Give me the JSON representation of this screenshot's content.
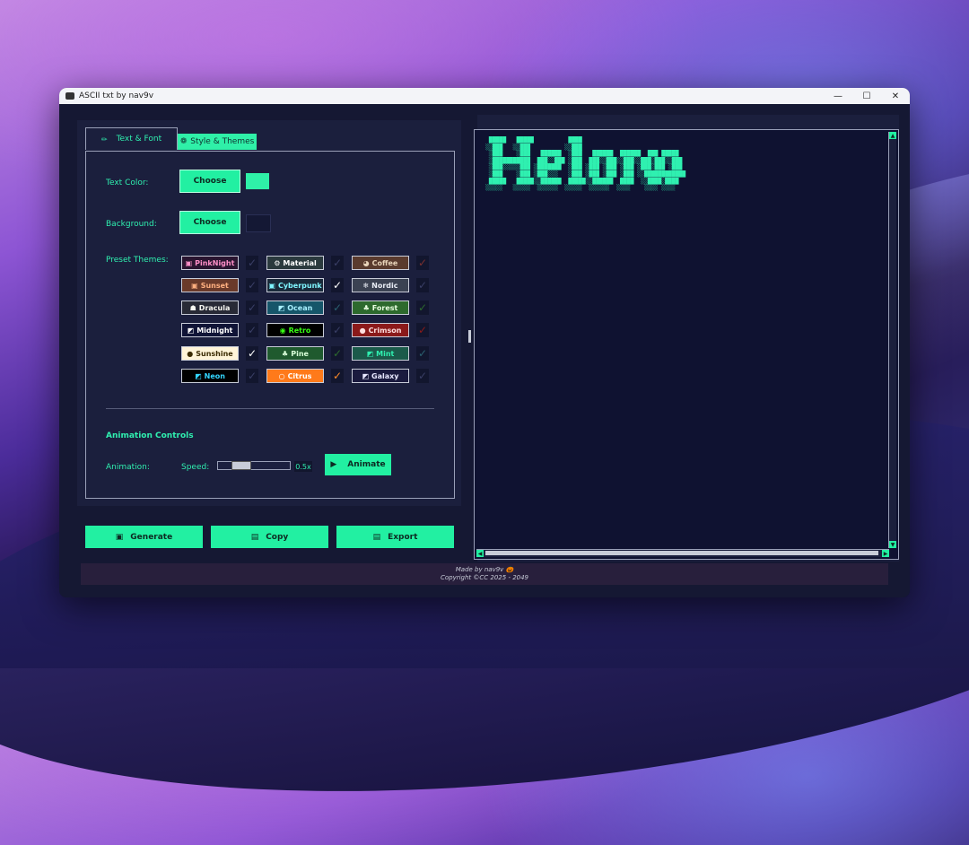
{
  "window": {
    "title": "ASCII txt by nav9v",
    "controls": [
      "—",
      "☐",
      "✕"
    ]
  },
  "tabs": [
    {
      "label": "Text & Font",
      "icon": "✏"
    },
    {
      "label": "Style & Themes",
      "icon": "❁"
    }
  ],
  "style": {
    "text_color_label": "Text Color:",
    "background_label": "Background:",
    "choose_label": "Choose",
    "text_color_value": "#2ff0a8",
    "background_value": "#141834",
    "preset_label": "Preset Themes:"
  },
  "themes": [
    {
      "name": "PinkNight",
      "icon": "▣",
      "fg": "#ff8fc8",
      "bg": "#2a1530",
      "checked": false,
      "check_color": "#3a3f66"
    },
    {
      "name": "Material",
      "icon": "⚙",
      "fg": "#ffffff",
      "bg": "#2b3a3e",
      "checked": false,
      "check_color": "#3a3f66"
    },
    {
      "name": "Coffee",
      "icon": "◕",
      "fg": "#e8d3b9",
      "bg": "#5a3b2e",
      "checked": false,
      "check_color": "#7a3030"
    },
    {
      "name": "Sunset",
      "icon": "▣",
      "fg": "#ffb080",
      "bg": "#6a3a2a",
      "checked": false,
      "check_color": "#3a3f66"
    },
    {
      "name": "Cyberpunk",
      "icon": "▣",
      "fg": "#7ff6ff",
      "bg": "#1a2a3a",
      "checked": true,
      "check_color": "#ffffff"
    },
    {
      "name": "Nordic",
      "icon": "❄",
      "fg": "#e8ecf4",
      "bg": "#3b4252",
      "checked": false,
      "check_color": "#3a3f66"
    },
    {
      "name": "Dracula",
      "icon": "☗",
      "fg": "#f8f8f2",
      "bg": "#282a36",
      "checked": false,
      "check_color": "#3a3f66"
    },
    {
      "name": "Ocean",
      "icon": "◩",
      "fg": "#a8f0ff",
      "bg": "#16566a",
      "checked": false,
      "check_color": "#2a6070"
    },
    {
      "name": "Forest",
      "icon": "♣",
      "fg": "#e8ffe0",
      "bg": "#2d6a2d",
      "checked": false,
      "check_color": "#2d6a2d"
    },
    {
      "name": "Midnight",
      "icon": "◩",
      "fg": "#ffffff",
      "bg": "#101436",
      "checked": false,
      "check_color": "#3a3f66"
    },
    {
      "name": "Retro",
      "icon": "◉",
      "fg": "#39ff14",
      "bg": "#000000",
      "checked": false,
      "check_color": "#3a3f66"
    },
    {
      "name": "Crimson",
      "icon": "●",
      "fg": "#ffe0e0",
      "bg": "#8b1a1a",
      "checked": false,
      "check_color": "#8b1a1a"
    },
    {
      "name": "Sunshine",
      "icon": "●",
      "fg": "#3a2a00",
      "bg": "#fff4d8",
      "checked": true,
      "check_color": "#ffffff"
    },
    {
      "name": "Pine",
      "icon": "♣",
      "fg": "#d8ffd8",
      "bg": "#1f5a2e",
      "checked": false,
      "check_color": "#2d6a2d"
    },
    {
      "name": "Mint",
      "icon": "◩",
      "fg": "#2ff0b0",
      "bg": "#1b5a4a",
      "checked": false,
      "check_color": "#2a6070"
    },
    {
      "name": "Neon",
      "icon": "◩",
      "fg": "#33d6ff",
      "bg": "#000000",
      "checked": false,
      "check_color": "#3a3f66"
    },
    {
      "name": "Citrus",
      "icon": "○",
      "fg": "#ffffff",
      "bg": "#ff7a1a",
      "checked": true,
      "check_color": "#ff8a2a"
    },
    {
      "name": "Galaxy",
      "icon": "◩",
      "fg": "#e8e8ff",
      "bg": "#1a1a3e",
      "checked": false,
      "check_color": "#3a3f66"
    }
  ],
  "animation": {
    "section_title": "Animation Controls",
    "label": "Animation:",
    "speed_label": "Speed:",
    "speed_value": "0.5x",
    "speed_fraction": 0.25,
    "animate_label": "Animate",
    "animate_icon": "▶"
  },
  "actions": [
    {
      "label": "Generate",
      "icon": "▣"
    },
    {
      "label": "Copy",
      "icon": "▤"
    },
    {
      "label": "Export",
      "icon": "▤"
    }
  ],
  "output": {
    "ascii": " █████   █████          ████\n░░███   ░░███          ░░███\n ░███    ░███   ██████  ░███   ██████  ██████  ███ █████\n ░███████████  ███░░███ ░███  ███░░███░░███░░███░███░░███\n ░███░░░░░███ ░███████  ░███ ░███ ░███ ░███ ░███░███ ░███\n ░███    ░███ ░███░░░   ░███ ░███ ░███ ░███ ░░████████████\n █████   █████░░██████  █████░░██████  ████  ░░████░████\n░░░░░   ░░░░░  ░░░░░░  ░░░░░  ░░░░░░  ░░░░    ░░░░ ░░░░"
  },
  "footer": {
    "line1": "Made by nav9v 🎃",
    "line2": "Copyright ©CC 2025 - 2049"
  }
}
